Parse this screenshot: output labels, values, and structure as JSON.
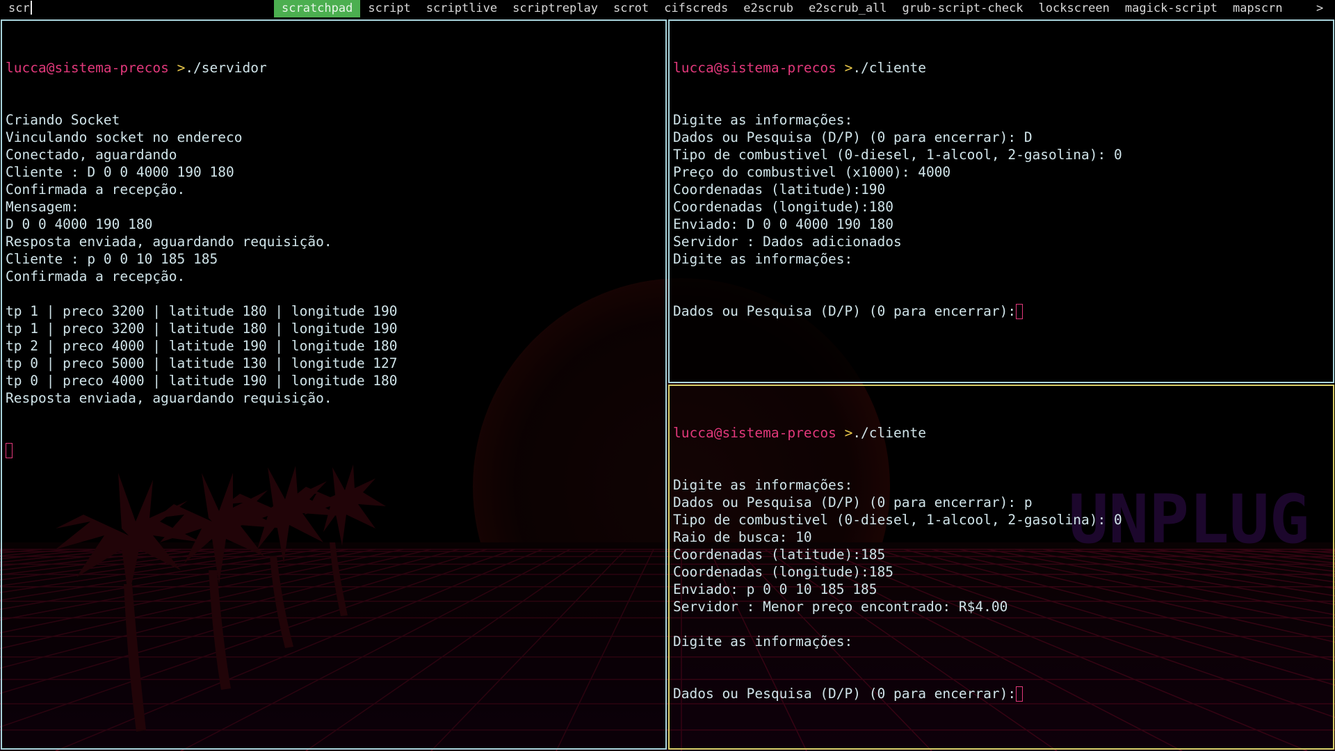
{
  "menubar": {
    "input_value": "scr",
    "items": [
      {
        "label": "scratchpad",
        "selected": true
      },
      {
        "label": "script",
        "selected": false
      },
      {
        "label": "scriptlive",
        "selected": false
      },
      {
        "label": "scriptreplay",
        "selected": false
      },
      {
        "label": "scrot",
        "selected": false
      },
      {
        "label": "cifscreds",
        "selected": false
      },
      {
        "label": "e2scrub",
        "selected": false
      },
      {
        "label": "e2scrub_all",
        "selected": false
      },
      {
        "label": "grub-script-check",
        "selected": false
      },
      {
        "label": "lockscreen",
        "selected": false
      },
      {
        "label": "magick-script",
        "selected": false
      },
      {
        "label": "mapscrn",
        "selected": false
      }
    ],
    "more_indicator": ">"
  },
  "wallpaper": {
    "text": "UNPLUG",
    "icons": [
      "palm-tree-icon",
      "sun-icon"
    ]
  },
  "terminals": {
    "server": {
      "prompt": {
        "user": "lucca",
        "at": "@",
        "host": "sistema-precos",
        "symbol": " >",
        "command": "./servidor"
      },
      "lines": [
        "Criando Socket",
        "Vinculando socket no endereco",
        "Conectado, aguardando",
        "Cliente : D 0 0 4000 190 180",
        "Confirmada a recepção.",
        "Mensagem:",
        "D 0 0 4000 190 180",
        "Resposta enviada, aguardando requisição.",
        "Cliente : p 0 0 10 185 185",
        "Confirmada a recepção.",
        "",
        "tp 1 | preco 3200 | latitude 180 | longitude 190",
        "tp 1 | preco 3200 | latitude 180 | longitude 190",
        "tp 2 | preco 4000 | latitude 190 | longitude 180",
        "tp 0 | preco 5000 | latitude 130 | longitude 127",
        "tp 0 | preco 4000 | latitude 190 | longitude 180",
        "Resposta enviada, aguardando requisição."
      ]
    },
    "client1": {
      "prompt": {
        "user": "lucca",
        "at": "@",
        "host": "sistema-precos",
        "symbol": " >",
        "command": "./cliente"
      },
      "lines": [
        "Digite as informações:",
        "Dados ou Pesquisa (D/P) (0 para encerrar): D",
        "Tipo de combustivel (0-diesel, 1-alcool, 2-gasolina): 0",
        "Preço do combustivel (x1000): 4000",
        "Coordenadas (latitude):190",
        "Coordenadas (longitude):180",
        "Enviado: D 0 0 4000 190 180",
        "Servidor : Dados adicionados",
        "Digite as informações:"
      ],
      "current_line": "Dados ou Pesquisa (D/P) (0 para encerrar):"
    },
    "client2": {
      "prompt": {
        "user": "lucca",
        "at": "@",
        "host": "sistema-precos",
        "symbol": " >",
        "command": "./cliente"
      },
      "lines": [
        "Digite as informações:",
        "Dados ou Pesquisa (D/P) (0 para encerrar): p",
        "Tipo de combustivel (0-diesel, 1-alcool, 2-gasolina): 0",
        "Raio de busca: 10",
        "Coordenadas (latitude):185",
        "Coordenadas (longitude):185",
        "Enviado: p 0 0 10 185 185",
        "Servidor : Menor preço encontrado: R$4.00",
        "",
        "Digite as informações:"
      ],
      "current_line": "Dados ou Pesquisa (D/P) (0 para encerrar):"
    }
  }
}
